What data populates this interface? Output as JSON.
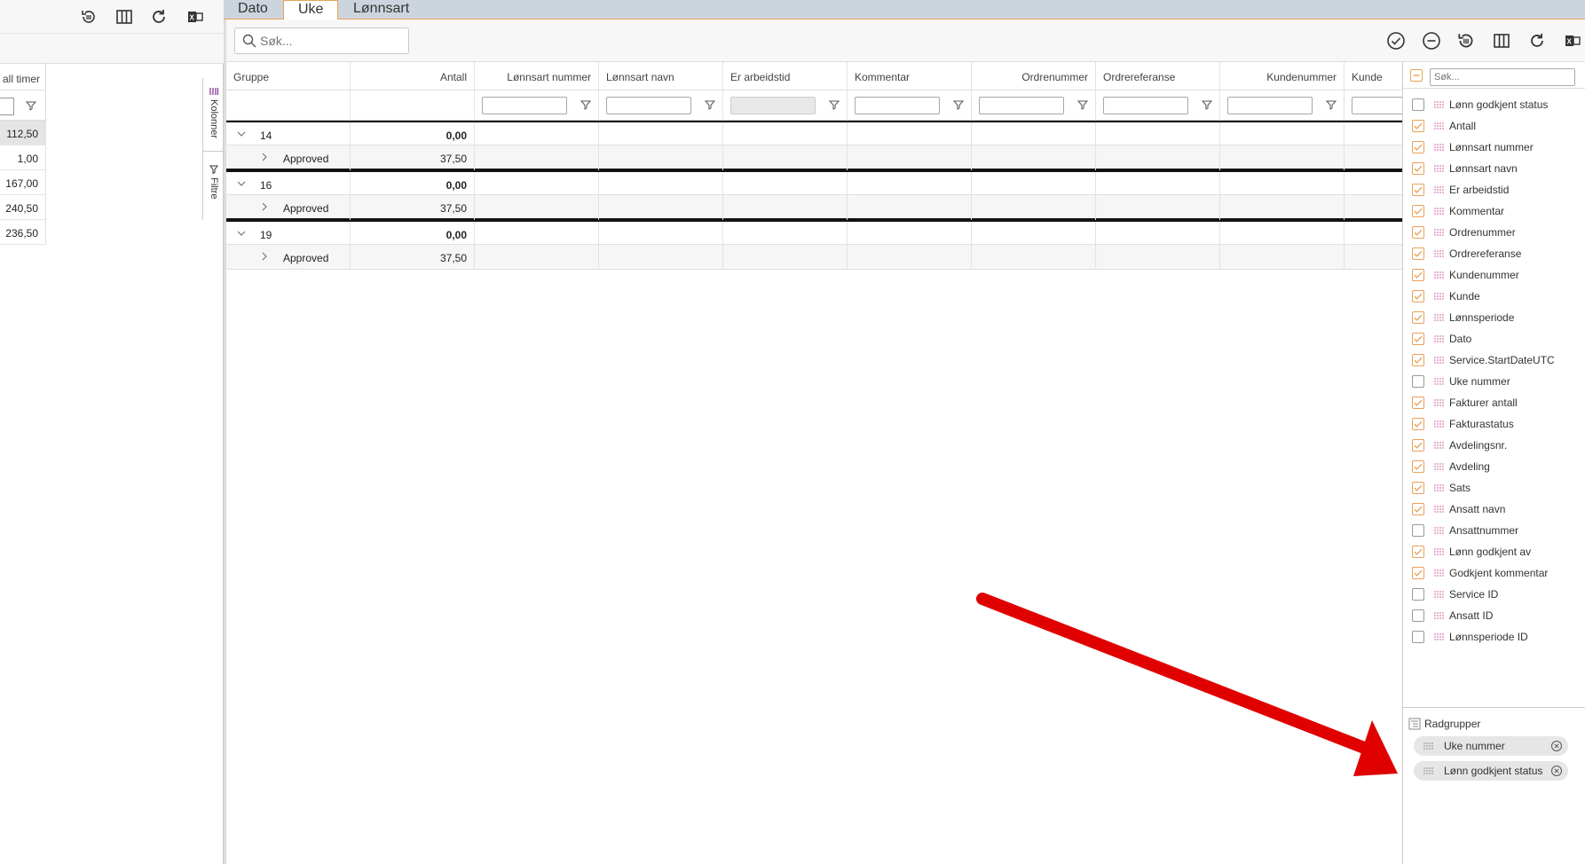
{
  "tabs": [
    {
      "label": "Dato"
    },
    {
      "label": "Uke"
    },
    {
      "label": "Lønnsart"
    }
  ],
  "left_panel": {
    "header": "all timer",
    "values": [
      "112,50",
      "1,00",
      "167,00",
      "240,50",
      "236,50"
    ],
    "side_tabs": [
      "Kolonner",
      "Filtre"
    ]
  },
  "main": {
    "search_placeholder": "Søk...",
    "columns": [
      "Gruppe",
      "Antall",
      "Lønnsart nummer",
      "Lønnsart navn",
      "Er arbeidstid",
      "Kommentar",
      "Ordrenummer",
      "Ordrereferanse",
      "Kundenummer",
      "Kunde"
    ],
    "rows": [
      {
        "group": "14",
        "antall": "0,00",
        "sub_label": "Approved",
        "sub_antall": "37,50"
      },
      {
        "group": "16",
        "antall": "0,00",
        "sub_label": "Approved",
        "sub_antall": "37,50"
      },
      {
        "group": "19",
        "antall": "0,00",
        "sub_label": "Approved",
        "sub_antall": "37,50"
      }
    ]
  },
  "column_panel": {
    "search_placeholder": "Søk...",
    "items": [
      {
        "label": "Lønn godkjent status",
        "checked": false
      },
      {
        "label": "Antall",
        "checked": true
      },
      {
        "label": "Lønnsart nummer",
        "checked": true
      },
      {
        "label": "Lønnsart navn",
        "checked": true
      },
      {
        "label": "Er arbeidstid",
        "checked": true
      },
      {
        "label": "Kommentar",
        "checked": true
      },
      {
        "label": "Ordrenummer",
        "checked": true
      },
      {
        "label": "Ordrereferanse",
        "checked": true
      },
      {
        "label": "Kundenummer",
        "checked": true
      },
      {
        "label": "Kunde",
        "checked": true
      },
      {
        "label": "Lønnsperiode",
        "checked": true
      },
      {
        "label": "Dato",
        "checked": true
      },
      {
        "label": "Service.StartDateUTC",
        "checked": true
      },
      {
        "label": "Uke nummer",
        "checked": false
      },
      {
        "label": "Fakturer antall",
        "checked": true
      },
      {
        "label": "Fakturastatus",
        "checked": true
      },
      {
        "label": "Avdelingsnr.",
        "checked": true
      },
      {
        "label": "Avdeling",
        "checked": true
      },
      {
        "label": "Sats",
        "checked": true
      },
      {
        "label": "Ansatt navn",
        "checked": true
      },
      {
        "label": "Ansattnummer",
        "checked": false
      },
      {
        "label": "Lønn godkjent av",
        "checked": true
      },
      {
        "label": "Godkjent kommentar",
        "checked": true
      },
      {
        "label": "Service ID",
        "checked": false
      },
      {
        "label": "Ansatt ID",
        "checked": false
      },
      {
        "label": "Lønnsperiode ID",
        "checked": false
      }
    ],
    "row_groups_title": "Radgrupper",
    "row_groups": [
      "Uke nummer",
      "Lønn godkjent status"
    ]
  },
  "colors": {
    "accent": "#e8a25a",
    "arrow": "#e00000",
    "tabbar": "#ccd5dd"
  }
}
